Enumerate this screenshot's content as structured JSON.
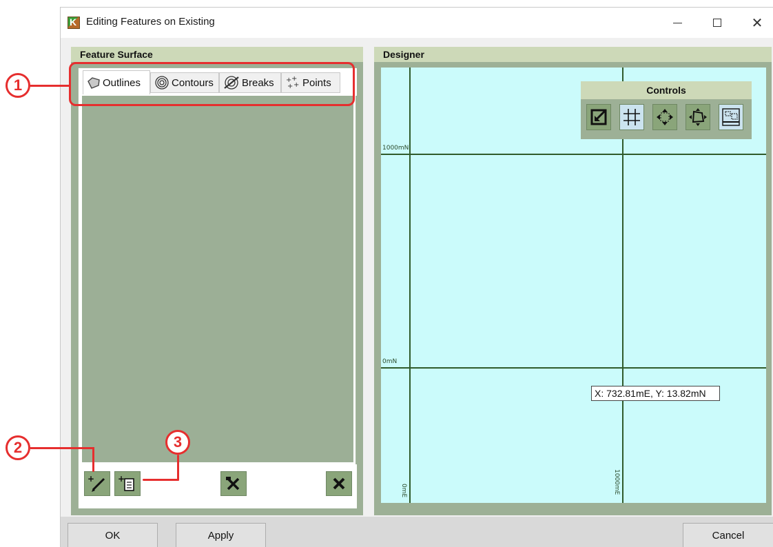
{
  "window": {
    "title": "Editing Features on Existing",
    "app_icon": "app-k-icon"
  },
  "feature_surface": {
    "title": "Feature Surface",
    "tabs": [
      {
        "label": "Outlines",
        "icon": "outline-shape-icon",
        "active": true
      },
      {
        "label": "Contours",
        "icon": "contours-icon",
        "active": false
      },
      {
        "label": "Breaks",
        "icon": "breaks-icon",
        "active": false
      },
      {
        "label": "Points",
        "icon": "points-icon",
        "active": false
      }
    ],
    "toolbar": [
      "add-draw-button",
      "add-from-file-button",
      "tools-button",
      "delete-button"
    ]
  },
  "designer": {
    "title": "Designer",
    "controls_title": "Controls",
    "controls": [
      "zoom-extents-icon",
      "grid-icon",
      "pan-icon",
      "rotate-icon",
      "layout-icon"
    ],
    "grid_labels": {
      "north_top": "1000mN",
      "north_bottom": "0mN",
      "east_left": "0mE",
      "east_right": "1000mE"
    },
    "cursor_readout": "X: 732.81mE, Y: 13.82mN"
  },
  "footer": {
    "ok": "OK",
    "apply": "Apply",
    "cancel": "Cancel"
  },
  "annotations": [
    "1",
    "2",
    "3"
  ],
  "colors": {
    "panel_header": "#cdd9b8",
    "panel_body": "#9db096",
    "canvas": "#cbfbfb",
    "grid_line": "#2f5a2a",
    "annotation_red": "#e62e2e"
  }
}
